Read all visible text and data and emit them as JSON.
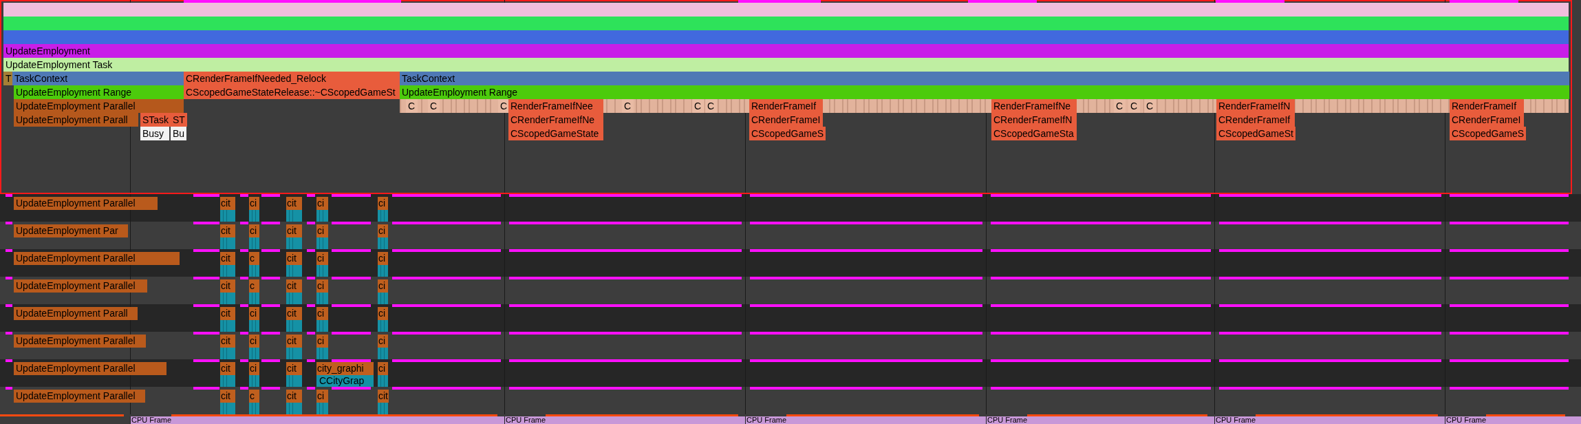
{
  "bands": [
    {
      "label": "UpdateEmployment",
      "kind": "function"
    },
    {
      "label": "UpdateEmployment Task",
      "kind": "task"
    }
  ],
  "main_rows": [
    [
      {
        "label": "T",
        "kind": "tag"
      },
      {
        "label": "TaskContext",
        "kind": "context"
      },
      {
        "label": "CRenderFrameIfNeeded_Relock",
        "kind": "render"
      },
      {
        "label": "TaskContext",
        "kind": "context"
      }
    ],
    [
      {
        "label": "UpdateEmployment Range",
        "kind": "range"
      },
      {
        "label": "CScopedGameStateRelease::~CScopedGameSt",
        "kind": "render"
      },
      {
        "label": "UpdateEmployment Range",
        "kind": "range"
      }
    ],
    [
      {
        "label": "UpdateEmployment Parallel",
        "kind": "parallel"
      },
      {
        "label": "C",
        "kind": "call"
      },
      {
        "label": "C",
        "kind": "call"
      },
      {
        "label": "C",
        "kind": "call"
      },
      {
        "label": "RenderFrameIfNee",
        "kind": "render"
      },
      {
        "label": "C",
        "kind": "call"
      },
      {
        "label": "C",
        "kind": "call"
      },
      {
        "label": "C",
        "kind": "call"
      },
      {
        "label": "RenderFrameIf",
        "kind": "render"
      },
      {
        "label": "RenderFrameIfNe",
        "kind": "render"
      },
      {
        "label": "C",
        "kind": "call"
      },
      {
        "label": "C",
        "kind": "call"
      },
      {
        "label": "C",
        "kind": "call"
      },
      {
        "label": "RenderFrameIfN",
        "kind": "render"
      },
      {
        "label": "RenderFrameIf",
        "kind": "render"
      }
    ],
    [
      {
        "label": "UpdateEmployment Parall",
        "kind": "parallel"
      },
      {
        "label": "STask",
        "kind": "render"
      },
      {
        "label": "ST",
        "kind": "render"
      },
      {
        "label": "CRenderFrameIfNe",
        "kind": "render"
      },
      {
        "label": "CRenderFrameI",
        "kind": "render"
      },
      {
        "label": "CRenderFrameIfN",
        "kind": "render"
      },
      {
        "label": "CRenderFrameIf",
        "kind": "render"
      },
      {
        "label": "CRenderFrameI",
        "kind": "render"
      }
    ],
    [
      {
        "label": "Busy",
        "kind": "busy"
      },
      {
        "label": "Bu",
        "kind": "busy"
      },
      {
        "label": "CScopedGameState",
        "kind": "render"
      },
      {
        "label": "CScopedGameS",
        "kind": "render"
      },
      {
        "label": "CScopedGameSta",
        "kind": "render"
      },
      {
        "label": "CScopedGameSt",
        "kind": "render"
      },
      {
        "label": "CScopedGameS",
        "kind": "render"
      }
    ]
  ],
  "threads": [
    {
      "label": "UpdateEmployment Parallel",
      "slices": [
        {
          "label": "cit"
        },
        {
          "label": "ci"
        },
        {
          "label": "cit"
        },
        {
          "label": "ci"
        },
        {
          "label": "ci"
        }
      ]
    },
    {
      "label": "UpdateEmployment Par",
      "slices": [
        {
          "label": "cit"
        },
        {
          "label": "ci"
        },
        {
          "label": "cit"
        },
        {
          "label": "ci"
        },
        {
          "label": "ci"
        }
      ]
    },
    {
      "label": "UpdateEmployment Parallel",
      "slices": [
        {
          "label": "cit"
        },
        {
          "label": "c"
        },
        {
          "label": "cit"
        },
        {
          "label": "ci"
        },
        {
          "label": "ci"
        }
      ]
    },
    {
      "label": "UpdateEmployment Parallel",
      "slices": [
        {
          "label": "cit"
        },
        {
          "label": "c"
        },
        {
          "label": "cit"
        },
        {
          "label": "ci"
        },
        {
          "label": "ci"
        }
      ]
    },
    {
      "label": "UpdateEmployment Parall",
      "slices": [
        {
          "label": "cit"
        },
        {
          "label": "ci"
        },
        {
          "label": "cit"
        },
        {
          "label": "ci"
        },
        {
          "label": "ci"
        }
      ]
    },
    {
      "label": "UpdateEmployment Parallel",
      "slices": [
        {
          "label": "cit"
        },
        {
          "label": "ci"
        },
        {
          "label": "cit"
        },
        {
          "label": "ci"
        },
        {
          "label": "ci"
        }
      ]
    },
    {
      "label": "UpdateEmployment Parallel",
      "slices": [
        {
          "label": "cit"
        },
        {
          "label": "ci"
        },
        {
          "label": "cit"
        },
        {
          "label": "city_graphi",
          "child": "CCityGrap"
        },
        {
          "label": "ci"
        }
      ]
    },
    {
      "label": "UpdateEmployment Parallel",
      "slices": [
        {
          "label": "cit"
        },
        {
          "label": "c"
        },
        {
          "label": "cit"
        },
        {
          "label": "ci"
        },
        {
          "label": "cit"
        }
      ]
    }
  ],
  "cpu_frames": [
    {
      "label": "CPU Frame"
    },
    {
      "label": "CPU Frame"
    },
    {
      "label": "CPU Frame"
    },
    {
      "label": "CPU Frame"
    },
    {
      "label": "CPU Frame"
    },
    {
      "label": "CPU Frame"
    }
  ]
}
